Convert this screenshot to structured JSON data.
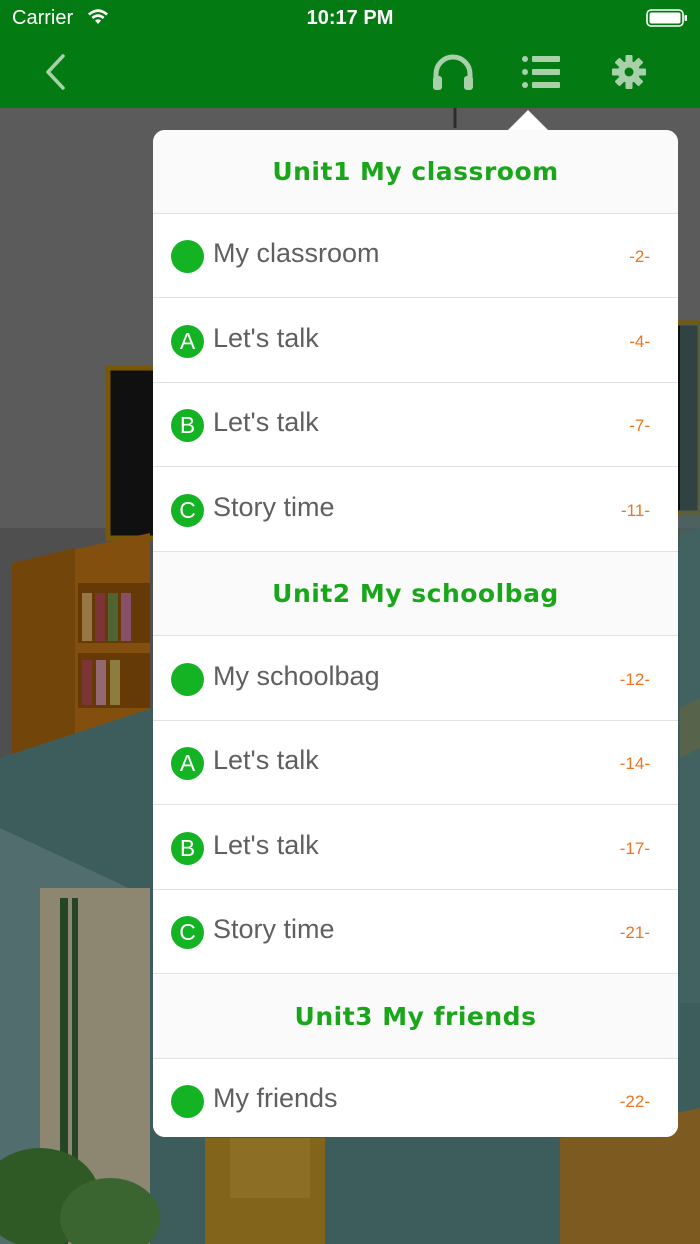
{
  "status_bar": {
    "carrier": "Carrier",
    "time": "10:17 PM"
  },
  "nav": {
    "icons": [
      "back-chevron-icon",
      "headphones-icon",
      "list-icon",
      "gear-icon"
    ],
    "bar_color": "#047a12"
  },
  "menu": {
    "accent_green": "#13b324",
    "unit_title_color": "#1aa61a",
    "page_color": "#f0731e",
    "rows": [
      {
        "type": "unit",
        "title": "Unit1 My classroom"
      },
      {
        "type": "lesson",
        "badge": "",
        "title": "My classroom",
        "page": "-2-"
      },
      {
        "type": "lesson",
        "badge": "A",
        "title": "Let's talk",
        "page": "-4-"
      },
      {
        "type": "lesson",
        "badge": "B",
        "title": "Let's talk",
        "page": "-7-"
      },
      {
        "type": "lesson",
        "badge": "C",
        "title": "Story time",
        "page": "-11-"
      },
      {
        "type": "unit",
        "title": "Unit2 My schoolbag"
      },
      {
        "type": "lesson",
        "badge": "",
        "title": "My schoolbag",
        "page": "-12-"
      },
      {
        "type": "lesson",
        "badge": "A",
        "title": "Let's talk",
        "page": "-14-"
      },
      {
        "type": "lesson",
        "badge": "B",
        "title": "Let's talk",
        "page": "-17-"
      },
      {
        "type": "lesson",
        "badge": "C",
        "title": "Story time",
        "page": "-21-"
      },
      {
        "type": "unit",
        "title": "Unit3 My friends"
      },
      {
        "type": "lesson",
        "badge": "",
        "title": "My friends",
        "page": "-22-"
      }
    ]
  }
}
